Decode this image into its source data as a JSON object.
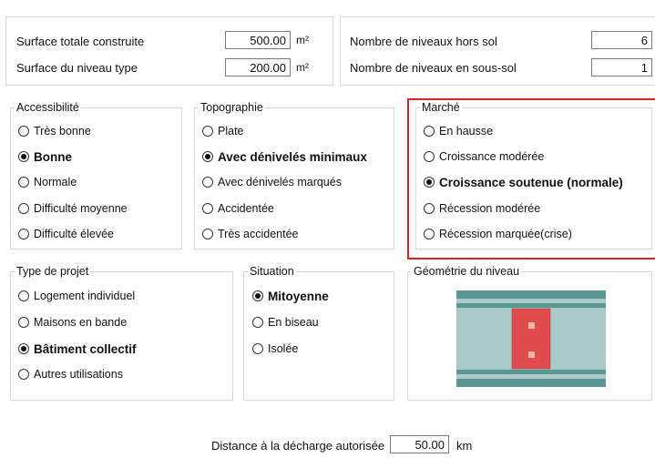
{
  "top_left": {
    "surface_totale": {
      "label": "Surface totale construite",
      "value": "500.00",
      "unit": "m²"
    },
    "surface_niveau": {
      "label": "Surface du niveau type",
      "value": "200.00",
      "unit": "m²"
    }
  },
  "top_right": {
    "niveaux_hors_sol": {
      "label": "Nombre de niveaux hors sol",
      "value": "6"
    },
    "niveaux_sous_sol": {
      "label": "Nombre de niveaux en sous-sol",
      "value": "1"
    }
  },
  "accessibilite": {
    "title": "Accessibilité",
    "options": [
      "Très bonne",
      "Bonne",
      "Normale",
      "Difficulté moyenne",
      "Difficulté élevée"
    ],
    "selected_index": 1
  },
  "topographie": {
    "title": "Topographie",
    "options": [
      "Plate",
      "Avec dénivelés minimaux",
      "Avec dénivelés marqués",
      "Accidentée",
      "Très accidentée"
    ],
    "selected_index": 1
  },
  "marche": {
    "title": "Marché",
    "options": [
      "En hausse",
      "Croissance modérée",
      "Croissance soutenue (normale)",
      "Récession modérée",
      "Récession marquée(crise)"
    ],
    "selected_index": 2,
    "highlight_color": "#e02020"
  },
  "type_projet": {
    "title": "Type de projet",
    "options": [
      "Logement individuel",
      "Maisons en bande",
      "Bâtiment collectif",
      "Autres utilisations"
    ],
    "selected_index": 2
  },
  "situation": {
    "title": "Situation",
    "options": [
      "Mitoyenne",
      "En biseau",
      "Isolée"
    ],
    "selected_index": 0
  },
  "geometrie": {
    "title": "Géométrie du niveau",
    "colors": {
      "band_dark": "#5a9693",
      "band_light": "#a9cac8",
      "building": "#e24b4b",
      "window": "#f0b4a8"
    }
  },
  "distance": {
    "label": "Distance à la décharge autorisée",
    "value": "50.00",
    "unit": "km"
  }
}
